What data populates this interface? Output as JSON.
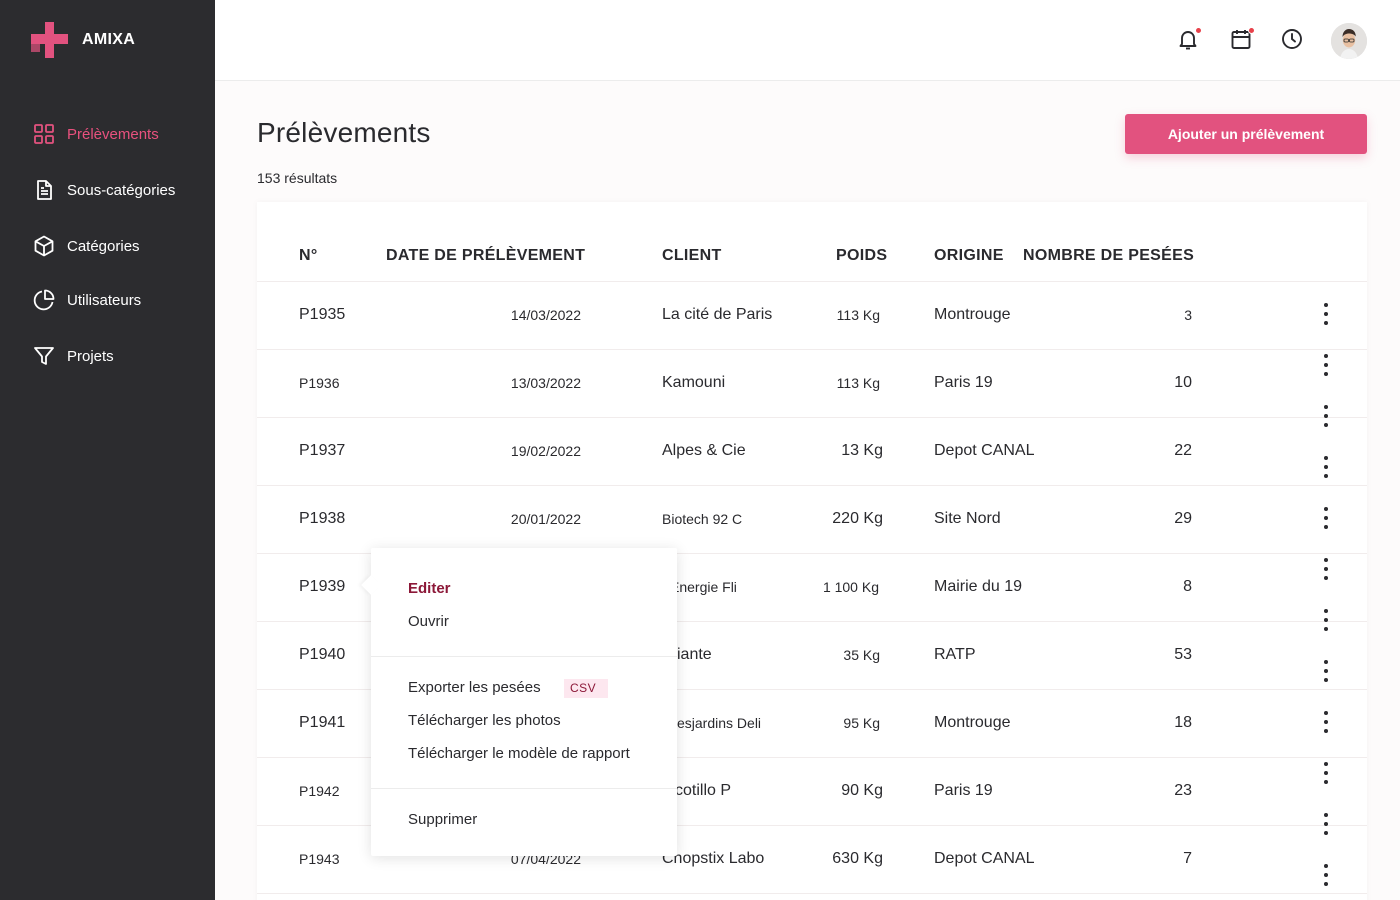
{
  "app": {
    "name": "AMIXA",
    "brand_color": "#e2527f",
    "sidebar_bg": "#2c2c2f"
  },
  "sidebar": {
    "items": [
      {
        "label": "Prélèvements",
        "icon": "grid-icon",
        "active": true
      },
      {
        "label": "Sous-catégories",
        "icon": "document-icon",
        "active": false
      },
      {
        "label": "Catégories",
        "icon": "cube-icon",
        "active": false
      },
      {
        "label": "Utilisateurs",
        "icon": "pie-chart-icon",
        "active": false
      },
      {
        "label": "Projets",
        "icon": "filter-icon",
        "active": false
      }
    ]
  },
  "topbar": {
    "icons": [
      "bell-icon",
      "calendar-icon",
      "clock-icon"
    ],
    "notification_dots": {
      "bell": true,
      "calendar": true,
      "clock": false
    }
  },
  "page": {
    "title": "Prélèvements",
    "result_count": "153 résultats",
    "add_button": "Ajouter un prélèvement"
  },
  "table": {
    "headers": {
      "number": "N°",
      "date": "DATE DE PRÉLÈVEMENT",
      "client": "CLIENT",
      "weight": "POIDS",
      "origin": "ORIGINE",
      "count": "NOMBRE DE PESÉES"
    },
    "rows": [
      {
        "number": "P1935",
        "date": "14/03/2022",
        "client": "La cité de Paris",
        "weight": "113 Kg",
        "origin": "Montrouge",
        "count": "3"
      },
      {
        "number": "P1936",
        "date": "13/03/2022",
        "client": "Kamouni",
        "weight": "113 Kg",
        "origin": "Paris 19",
        "count": "10"
      },
      {
        "number": "P1937",
        "date": "19/02/2022",
        "client": "Alpes & Cie",
        "weight": "13 Kg",
        "origin": "Depot CANAL",
        "count": "22"
      },
      {
        "number": "P1938",
        "date": "20/01/2022",
        "client": "Biotech 92 C",
        "weight": "220 Kg",
        "origin": "Site Nord",
        "count": "29"
      },
      {
        "number": "P1939",
        "date": "",
        "client": "Énergie Fli",
        "weight": "1 100 Kg",
        "origin": "Mairie du 19",
        "count": "8"
      },
      {
        "number": "P1940",
        "date": "",
        "client": "iante",
        "weight": "35 Kg",
        "origin": "RATP",
        "count": "53"
      },
      {
        "number": "P1941",
        "date": "",
        "client": "esjardins Deli",
        "weight": "95 Kg",
        "origin": "Montrouge",
        "count": "18"
      },
      {
        "number": "P1942",
        "date": "",
        "client": "cotillo P",
        "weight": "90 Kg",
        "origin": "Paris 19",
        "count": "23"
      },
      {
        "number": "P1943",
        "date": "07/04/2022",
        "client": "Chopstix Labo",
        "weight": "630 Kg",
        "origin": "Depot CANAL",
        "count": "7"
      }
    ]
  },
  "context_menu": {
    "edit": "Editer",
    "open": "Ouvrir",
    "export": "Exporter les pesées",
    "export_badge": "CSV",
    "download_photos": "Télécharger les photos",
    "download_template": "Télécharger le modèle de rapport",
    "delete": "Supprimer"
  }
}
